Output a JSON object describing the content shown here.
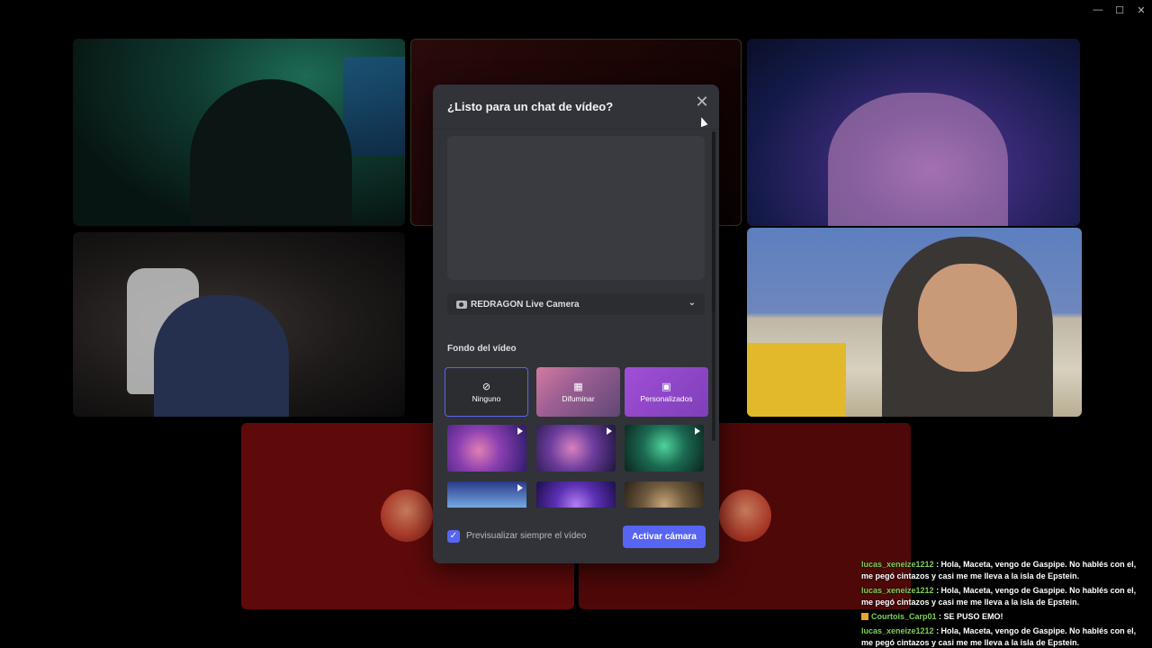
{
  "window": {
    "minimize_glyph": "—",
    "maximize_glyph": "☐",
    "close_glyph": "✕"
  },
  "modal": {
    "title": "¿Listo para un chat de vídeo?",
    "close_glyph": "✕",
    "camera_select": {
      "value": "REDRAGON Live Camera",
      "chevron_glyph": "⌄"
    },
    "background_section_label": "Fondo del vídeo",
    "background_options": [
      {
        "label": "Ninguno",
        "icon": "ban-icon",
        "glyph": "⊘"
      },
      {
        "label": "Difuminar",
        "icon": "blur-icon",
        "glyph": "▦"
      },
      {
        "label": "Personalizados",
        "icon": "image-add-icon",
        "glyph": "▣"
      }
    ],
    "preview_checkbox": {
      "label": "Previsualizar siempre el vídeo",
      "checked": true,
      "glyph": "✓"
    },
    "primary_button": "Activar cámara"
  },
  "chat": [
    {
      "user": "lucas_xeneize1212",
      "text": " : Hola, Maceta, vengo de Gaspipe. No hablés con el, me pegó cintazos y casi me me lleva a la isla de Epstein."
    },
    {
      "user": "lucas_xeneize1212",
      "text": " : Hola, Maceta, vengo de Gaspipe. No hablés con el, me pegó cintazos y casi me me lleva a la isla de Epstein."
    },
    {
      "user": "Courtois_Carp01",
      "text": " : SE PUSO EMO!",
      "badge": true
    },
    {
      "user": "lucas_xeneize1212",
      "text": " : Hola, Maceta, vengo de Gaspipe. No hablés con el, me pegó cintazos y casi me me lleva a la isla de Epstein."
    }
  ],
  "colors": {
    "accent": "#5865f2",
    "modal_bg": "#313338",
    "chat_user": "#7fd05a"
  }
}
